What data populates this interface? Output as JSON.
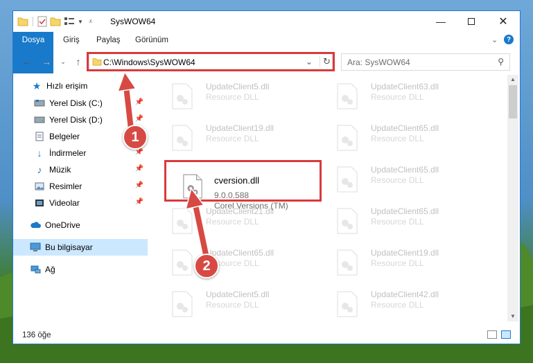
{
  "window": {
    "title": "SysWOW64"
  },
  "ribbon": {
    "tabs": [
      "Dosya",
      "Giriş",
      "Paylaş",
      "Görünüm"
    ]
  },
  "address": {
    "path": "C:\\Windows\\SysWOW64",
    "search_placeholder": "Ara: SysWOW64"
  },
  "sidebar": {
    "items": [
      {
        "label": "Hızlı erişim",
        "icon": "star-icon"
      },
      {
        "label": "Yerel Disk (C:)",
        "icon": "drive-icon",
        "pinned": true
      },
      {
        "label": "Yerel Disk (D:)",
        "icon": "drive-icon",
        "pinned": true
      },
      {
        "label": "Belgeler",
        "icon": "document-icon",
        "pinned": true
      },
      {
        "label": "İndirmeler",
        "icon": "download-icon",
        "pinned": true
      },
      {
        "label": "Müzik",
        "icon": "music-icon",
        "pinned": true
      },
      {
        "label": "Resimler",
        "icon": "pictures-icon",
        "pinned": true
      },
      {
        "label": "Videolar",
        "icon": "video-icon",
        "pinned": true
      },
      {
        "label": "OneDrive",
        "icon": "cloud-icon"
      },
      {
        "label": "Bu bilgisayar",
        "icon": "computer-icon",
        "selected": true
      },
      {
        "label": "Ağ",
        "icon": "network-icon"
      }
    ]
  },
  "files": {
    "left": [
      {
        "name": "UpdateClient5.dll",
        "desc": "Resource DLL"
      },
      {
        "name": "UpdateClient19.dll",
        "desc": "Resource DLL"
      },
      {
        "name": "cversion.dll",
        "version": "9.0.0.588",
        "company": "Corel Versions (TM)",
        "highlight": true
      },
      {
        "name": "UpdateClient21.dll",
        "desc": "Resource DLL"
      },
      {
        "name": "UpdateClient65.dll",
        "desc": "Resource DLL"
      },
      {
        "name": "UpdateClient5.dll",
        "desc": "Resource DLL"
      }
    ],
    "right": [
      {
        "name": "UpdateClient63.dll",
        "desc": "Resource DLL"
      },
      {
        "name": "UpdateClient65.dll",
        "desc": "Resource DLL"
      },
      {
        "name": "UpdateClient65.dll",
        "desc": "Resource DLL"
      },
      {
        "name": "UpdateClient65.dll",
        "desc": "Resource DLL"
      },
      {
        "name": "UpdateClient19.dll",
        "desc": "Resource DLL"
      },
      {
        "name": "UpdateClient42.dll",
        "desc": "Resource DLL"
      }
    ]
  },
  "status": {
    "count": "136 öğe"
  },
  "callouts": {
    "one": "1",
    "two": "2"
  },
  "colors": {
    "accent": "#1979ca",
    "highlight_red": "#d9393b",
    "badge_red": "#d74a44"
  }
}
